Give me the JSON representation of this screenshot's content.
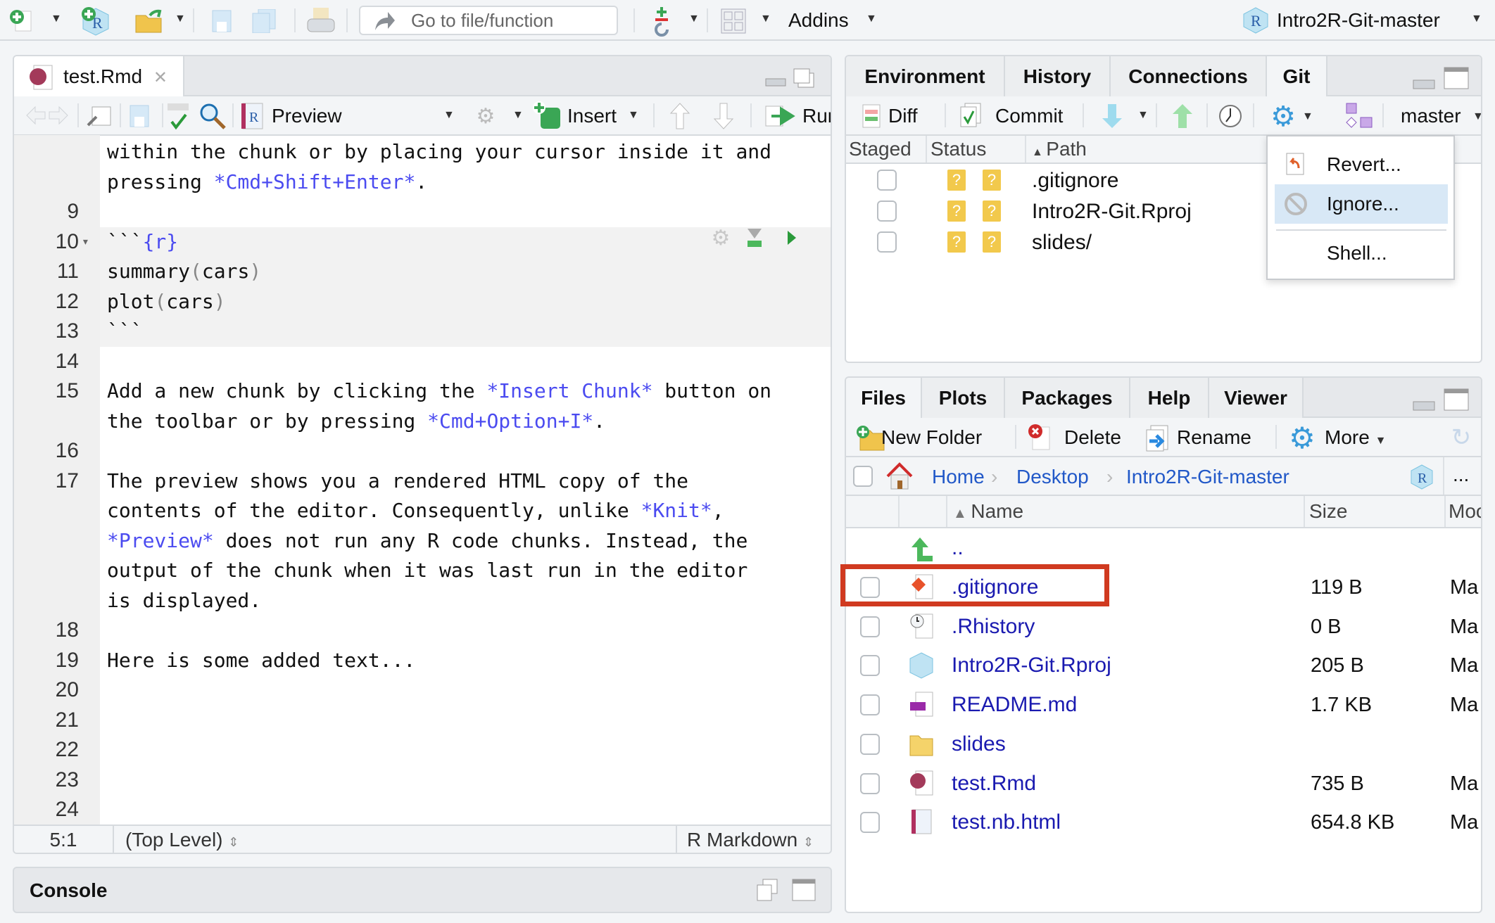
{
  "main_toolbar": {
    "goto_placeholder": "Go to file/function",
    "addins_label": "Addins",
    "project_label": "Intro2R-Git-master"
  },
  "editor": {
    "tab_label": "test.Rmd",
    "preview_label": "Preview",
    "insert_label": "Insert",
    "run_label": "Run",
    "lines": [
      {
        "n": "",
        "chunk": false,
        "segs": [
          [
            "t",
            "within the chunk or by placing your cursor inside it and"
          ]
        ]
      },
      {
        "n": "",
        "chunk": false,
        "segs": [
          [
            "t",
            "pressing "
          ],
          [
            "e",
            "*Cmd+Shift+Enter*"
          ],
          [
            "t",
            "."
          ]
        ]
      },
      {
        "n": "9",
        "chunk": false,
        "segs": []
      },
      {
        "n": "10",
        "chunk": true,
        "fold": true,
        "segs": [
          [
            "t",
            "```"
          ],
          [
            "e",
            "{r}"
          ]
        ]
      },
      {
        "n": "11",
        "chunk": true,
        "segs": [
          [
            "t",
            "summary"
          ],
          [
            "p",
            "("
          ],
          [
            "t",
            "cars"
          ],
          [
            "p",
            ")"
          ]
        ]
      },
      {
        "n": "12",
        "chunk": true,
        "segs": [
          [
            "t",
            "plot"
          ],
          [
            "p",
            "("
          ],
          [
            "t",
            "cars"
          ],
          [
            "p",
            ")"
          ]
        ]
      },
      {
        "n": "13",
        "chunk": true,
        "segs": [
          [
            "t",
            "```"
          ]
        ]
      },
      {
        "n": "14",
        "chunk": false,
        "segs": []
      },
      {
        "n": "15",
        "chunk": false,
        "segs": [
          [
            "t",
            "Add a new chunk by clicking the "
          ],
          [
            "e",
            "*Insert Chunk*"
          ],
          [
            "t",
            " button on"
          ]
        ]
      },
      {
        "n": "",
        "chunk": false,
        "segs": [
          [
            "t",
            "the toolbar or by pressing "
          ],
          [
            "e",
            "*Cmd+Option+I*"
          ],
          [
            "t",
            "."
          ]
        ]
      },
      {
        "n": "16",
        "chunk": false,
        "segs": []
      },
      {
        "n": "17",
        "chunk": false,
        "segs": [
          [
            "t",
            "The preview shows you a rendered HTML copy of the"
          ]
        ]
      },
      {
        "n": "",
        "chunk": false,
        "segs": [
          [
            "t",
            "contents of the editor. Consequently, unlike "
          ],
          [
            "e",
            "*Knit*"
          ],
          [
            "t",
            ","
          ]
        ]
      },
      {
        "n": "",
        "chunk": false,
        "segs": [
          [
            "e",
            "*Preview*"
          ],
          [
            "t",
            " does not run any R code chunks. Instead, the"
          ]
        ]
      },
      {
        "n": "",
        "chunk": false,
        "segs": [
          [
            "t",
            "output of the chunk when it was last run in the editor"
          ]
        ]
      },
      {
        "n": "",
        "chunk": false,
        "segs": [
          [
            "t",
            "is displayed."
          ]
        ]
      },
      {
        "n": "18",
        "chunk": false,
        "segs": []
      },
      {
        "n": "19",
        "chunk": false,
        "segs": [
          [
            "t",
            "Here is some added text..."
          ]
        ]
      },
      {
        "n": "20",
        "chunk": false,
        "segs": []
      },
      {
        "n": "21",
        "chunk": false,
        "segs": []
      },
      {
        "n": "22",
        "chunk": false,
        "segs": []
      },
      {
        "n": "23",
        "chunk": false,
        "segs": []
      },
      {
        "n": "24",
        "chunk": false,
        "segs": []
      }
    ],
    "status": {
      "position": "5:1",
      "scope": "(Top Level)",
      "mode": "R Markdown"
    }
  },
  "console": {
    "title": "Console"
  },
  "top_right": {
    "tabs": [
      "Environment",
      "History",
      "Connections",
      "Git"
    ],
    "active_tab": "Git",
    "diff_label": "Diff",
    "commit_label": "Commit",
    "branch": "master",
    "columns": [
      "Staged",
      "Status",
      "Path"
    ],
    "rows": [
      {
        "path": ".gitignore",
        "status": [
          "?",
          "?"
        ]
      },
      {
        "path": "Intro2R-Git.Rproj",
        "status": [
          "?",
          "?"
        ]
      },
      {
        "path": "slides/",
        "status": [
          "?",
          "?"
        ]
      }
    ],
    "menu": {
      "items": [
        "Revert...",
        "Ignore...",
        "Shell..."
      ],
      "highlighted": "Ignore..."
    }
  },
  "bottom_right": {
    "tabs": [
      "Files",
      "Plots",
      "Packages",
      "Help",
      "Viewer"
    ],
    "active_tab": "Files",
    "new_folder_label": "New Folder",
    "delete_label": "Delete",
    "rename_label": "Rename",
    "more_label": "More",
    "breadcrumb": [
      "Home",
      "Desktop",
      "Intro2R-Git-master"
    ],
    "breadcrumb_more": "...",
    "columns": [
      "Name",
      "Size",
      "Modified"
    ],
    "columns_visible": [
      "Name",
      "Size",
      "Moc"
    ],
    "parent_label": "..",
    "files": [
      {
        "name": ".gitignore",
        "size": "119 B",
        "mod": "Ma",
        "icon": "git-file-icon",
        "highlighted": true
      },
      {
        "name": ".Rhistory",
        "size": "0 B",
        "mod": "Ma",
        "icon": "history-file-icon"
      },
      {
        "name": "Intro2R-Git.Rproj",
        "size": "205 B",
        "mod": "Ma",
        "icon": "rproj-file-icon"
      },
      {
        "name": "README.md",
        "size": "1.7 KB",
        "mod": "Ma",
        "icon": "markdown-file-icon"
      },
      {
        "name": "slides",
        "size": "",
        "mod": "",
        "icon": "folder-icon"
      },
      {
        "name": "test.Rmd",
        "size": "735 B",
        "mod": "Ma",
        "icon": "rmd-file-icon"
      },
      {
        "name": "test.nb.html",
        "size": "654.8 KB",
        "mod": "Ma",
        "icon": "notebook-file-icon"
      }
    ],
    "highlight_color": "#d03a20"
  }
}
